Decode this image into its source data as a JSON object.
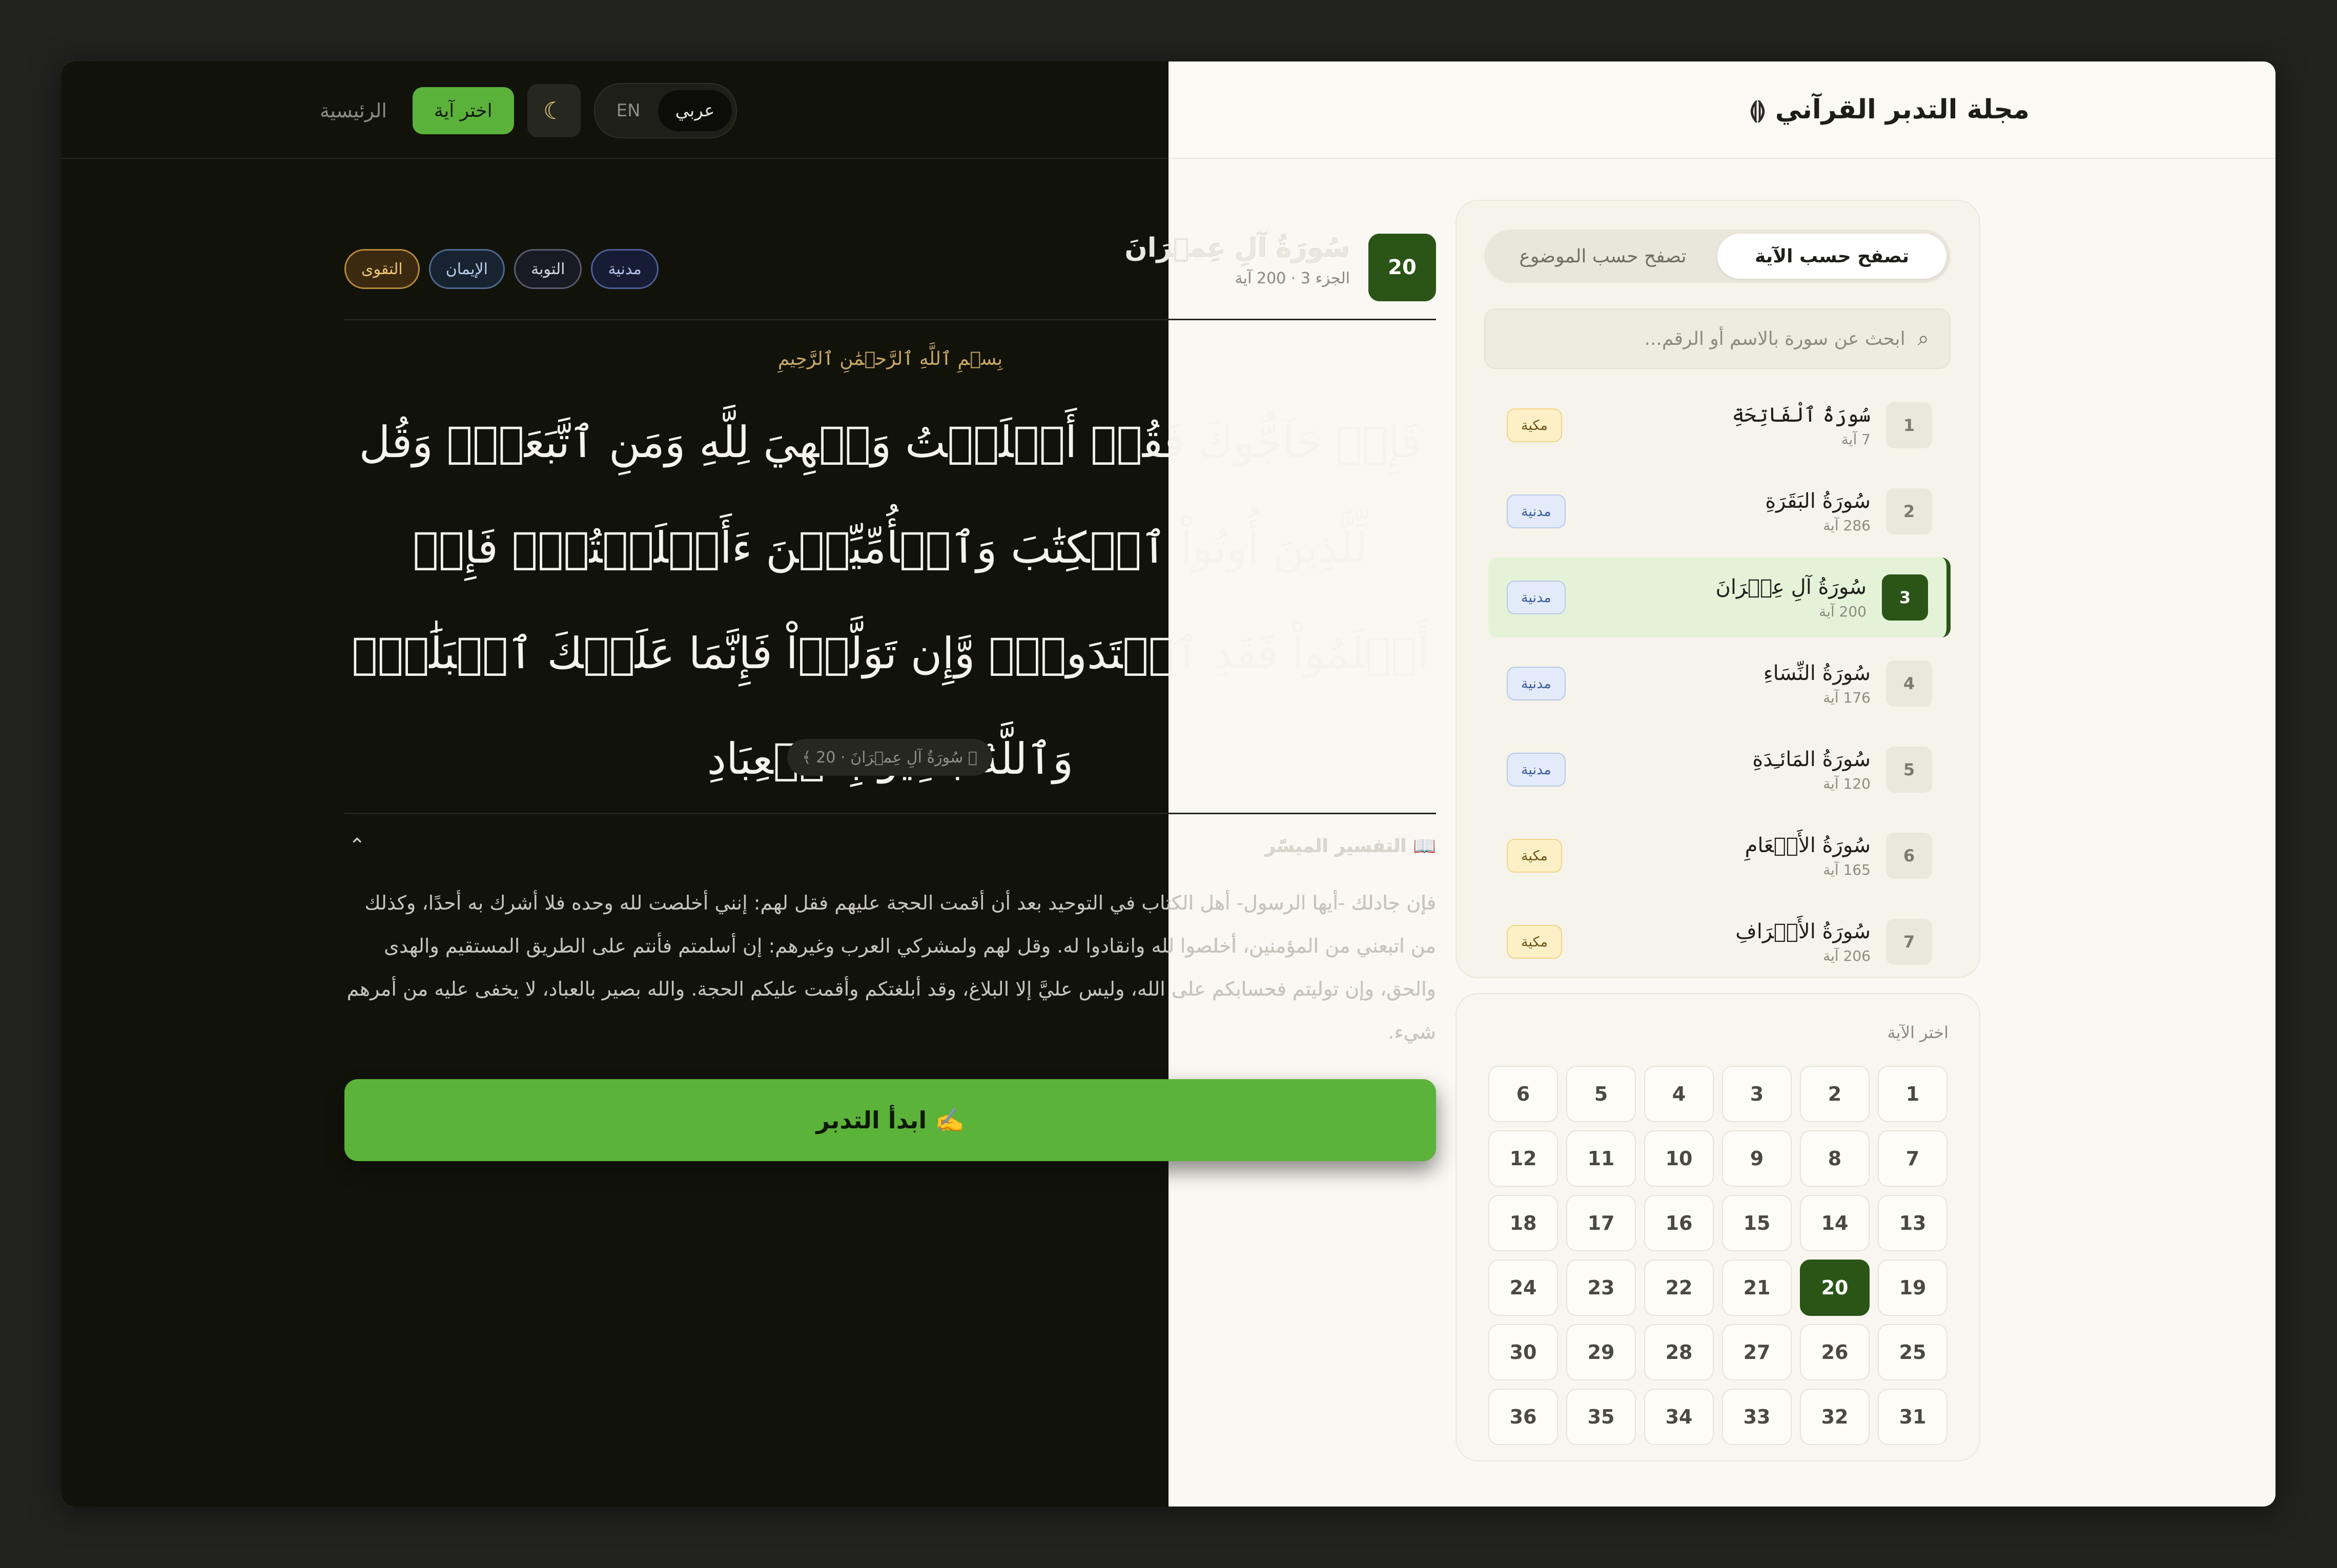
{
  "header": {
    "brand_title": "مجلة التدبر القرآني",
    "brand_icon": "quran-brackets-icon",
    "nav_home": "الرئيسية",
    "nav_pick_ayah": "اختر آية",
    "theme_icon": "moon-icon",
    "lang_ar": "عربي",
    "lang_en": "EN"
  },
  "colors": {
    "accent_green": "#5bb23a",
    "dark_green": "#2b5417",
    "dark_bg": "#111209",
    "light_bg": "#faf8f2"
  },
  "surah": {
    "number": "20",
    "name": "سُورَةُ آلِ عِمۡرَانَ",
    "meta": "الجزء 3 · 200 آية",
    "tags": [
      "التقوى",
      "الإيمان",
      "التوبة",
      "مدنية"
    ]
  },
  "verse": {
    "basmala": "بِسۡمِ ٱللَّهِ ٱلرَّحۡمَٰنِ ٱلرَّحِيمِ",
    "text": "فَإِنۡ حَآجُّوكَ فَقُلۡ أَسۡلَمۡتُ وَجۡهِيَ لِلَّهِ وَمَنِ ٱتَّبَعَنِۗ وَقُل لِّلَّذِينَ أُوتُواْ ٱلۡكِتَٰبَ وَٱلۡأُمِّيِّـۧنَ ءَأَسۡلَمۡتُمۡۚ فَإِنۡ أَسۡلَمُواْ فَقَدِ ٱهۡتَدَواْۖ وَّإِن تَوَلَّوۡاْ فَإِنَّمَا عَلَيۡكَ ٱلۡبَلَٰغُۗ وَٱللَّهُ بَصِيرُۢ بِٱلۡعِبَادِ",
    "reference": "﴿ سُورَةُ آلِ عِمۡرَانَ · 20 ﴾"
  },
  "tafsir": {
    "title": "📖 التفسير الميسّر",
    "text": "فإن جادلك -أيها الرسول- أهل الكتاب في التوحيد بعد أن أقمت الحجة عليهم فقل لهم: إنني أخلصت لله وحده فلا أشرك به أحدًا، وكذلك من اتبعني من المؤمنين، أخلصوا لله وانقادوا له. وقل لهم ولمشركي العرب وغيرهم: إن أسلمتم فأنتم على الطريق المستقيم والهدى والحق، وإن توليتم فحسابكم على الله، وليس عليَّ إلا البلاغ، وقد أبلغتكم وأقمت عليكم الحجة. والله بصير بالعباد، لا يخفى عليه من أمرهم شيء."
  },
  "start_button": "✍️ ابدأ التدبر",
  "sidebar": {
    "tab_by_ayah": "تصفح حسب الآية",
    "tab_by_topic": "تصفح حسب الموضوع",
    "search_placeholder": "ابحث عن سورة بالاسم أو الرقم...",
    "surahs": [
      {
        "num": "1",
        "name": "سُورَةُ ٱلْفَاتِحَةِ",
        "count": "7 آية",
        "type": "مكية",
        "kind": "makki"
      },
      {
        "num": "2",
        "name": "سُورَةُ البَقَرَةِ",
        "count": "286 آية",
        "type": "مدنية",
        "kind": "madani"
      },
      {
        "num": "3",
        "name": "سُورَةُ آلِ عِمۡرَانَ",
        "count": "200 آية",
        "type": "مدنية",
        "kind": "madani",
        "active": true
      },
      {
        "num": "4",
        "name": "سُورَةُ النِّسَاءِ",
        "count": "176 آية",
        "type": "مدنية",
        "kind": "madani"
      },
      {
        "num": "5",
        "name": "سُورَةُ المَائـِدَةِ",
        "count": "120 آية",
        "type": "مدنية",
        "kind": "madani"
      },
      {
        "num": "6",
        "name": "سُورَةُ الأَنۡعَامِ",
        "count": "165 آية",
        "type": "مكية",
        "kind": "makki"
      },
      {
        "num": "7",
        "name": "سُورَةُ الأَعۡرَافِ",
        "count": "206 آية",
        "type": "مكية",
        "kind": "makki"
      }
    ]
  },
  "ayah_picker": {
    "label": "اختر الآية",
    "numbers": [
      "1",
      "2",
      "3",
      "4",
      "5",
      "6",
      "7",
      "8",
      "9",
      "10",
      "11",
      "12",
      "13",
      "14",
      "15",
      "16",
      "17",
      "18",
      "19",
      "20",
      "21",
      "22",
      "23",
      "24",
      "25",
      "26",
      "27",
      "28",
      "29",
      "30",
      "31",
      "32",
      "33",
      "34",
      "35",
      "36"
    ],
    "selected": "20"
  }
}
